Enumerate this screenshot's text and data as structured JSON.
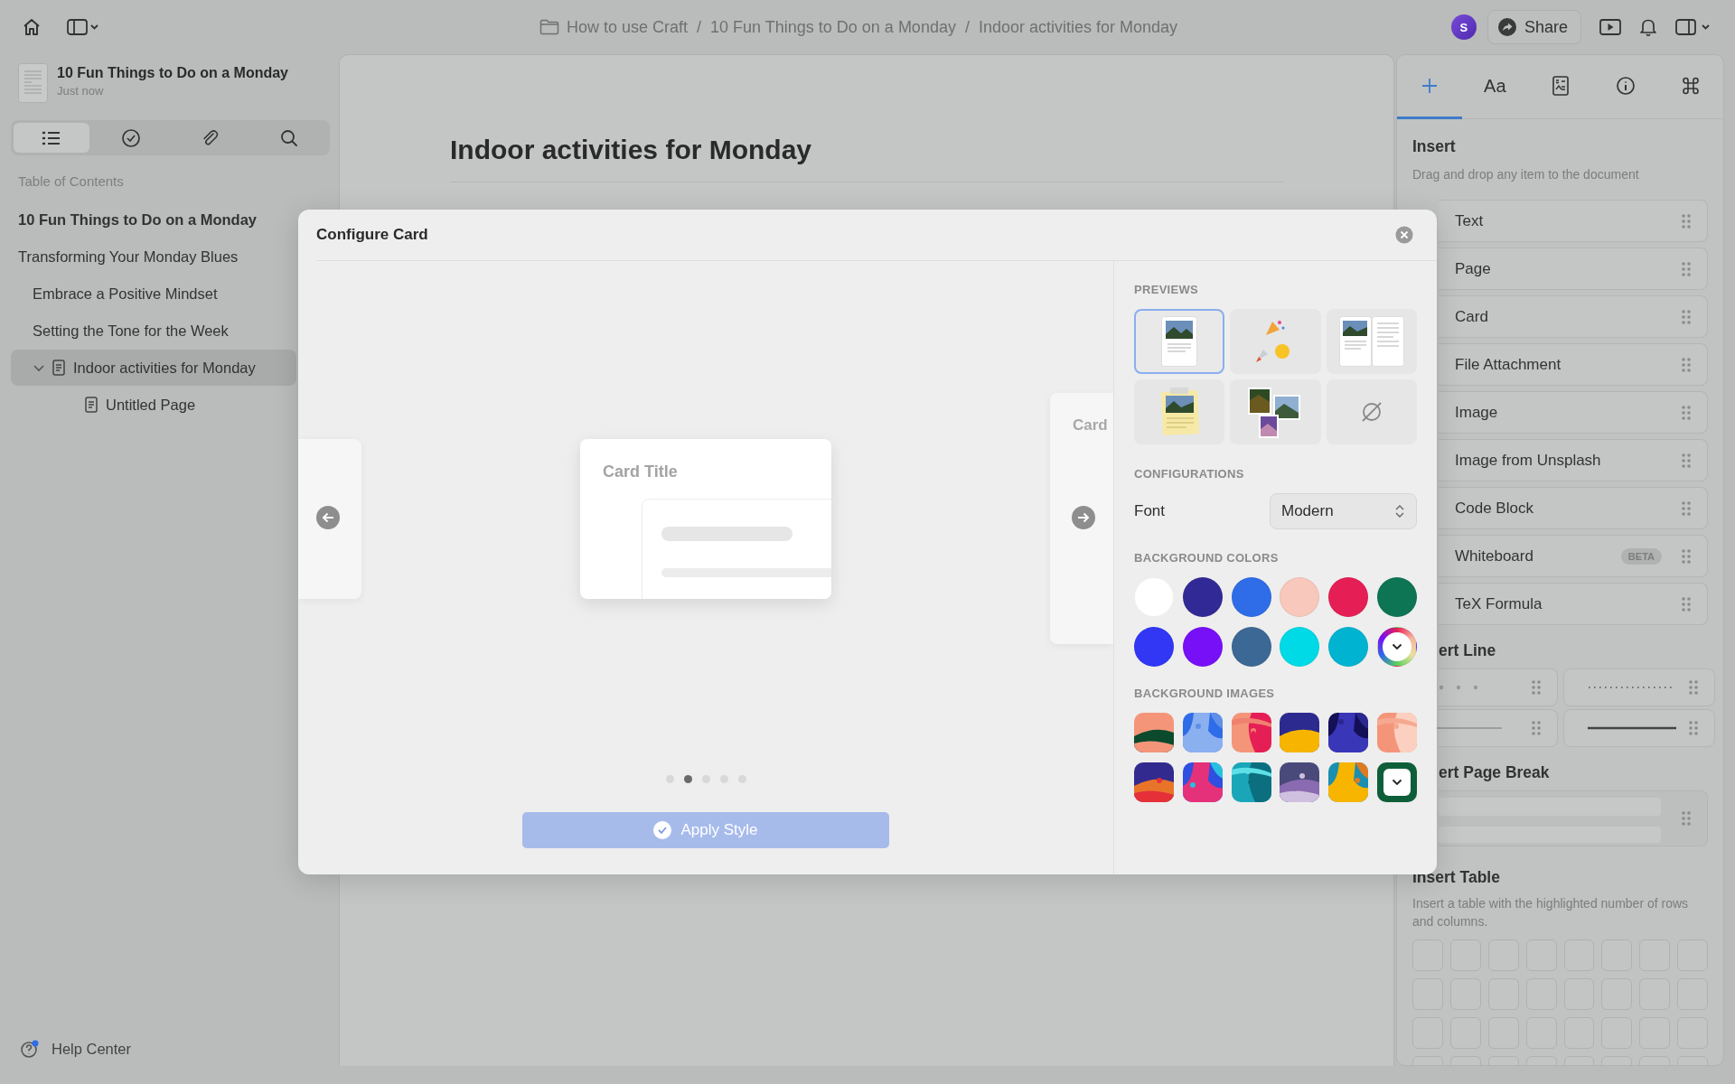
{
  "toolbar": {
    "breadcrumb": [
      {
        "label": "How to use Craft",
        "separator": "/"
      },
      {
        "label": "10 Fun Things to Do on a Monday",
        "separator": "/"
      },
      {
        "label": "Indoor activities for Monday"
      }
    ],
    "avatar": "S",
    "share": "Share"
  },
  "sidebar": {
    "document": {
      "title": "10 Fun Things to Do on a Monday",
      "updated": "Just now"
    },
    "view_tabs": [
      {
        "kind": "outline",
        "selected": true
      },
      {
        "kind": "tasks",
        "selected": false
      },
      {
        "kind": "attachments",
        "selected": false
      },
      {
        "kind": "search",
        "selected": false
      }
    ],
    "toc_heading": "Table of Contents",
    "toc": [
      {
        "kind": "document",
        "label": "10 Fun Things to Do on a Monday",
        "selected": false
      },
      {
        "kind": "heading",
        "label": "Transforming Your Monday Blues",
        "selected": false,
        "children": [
          {
            "kind": "heading",
            "label": "Embrace a Positive Mindset",
            "selected": false
          },
          {
            "kind": "heading",
            "label": "Setting the Tone for the Week",
            "selected": false
          },
          {
            "kind": "page",
            "label": "Indoor activities for Monday",
            "selected": true,
            "expanded": true,
            "children": [
              {
                "kind": "page",
                "label": "Untitled Page",
                "selected": false
              }
            ]
          }
        ]
      }
    ],
    "help": "Help Center"
  },
  "document": {
    "title": "Indoor activities for Monday"
  },
  "panel": {
    "tabs": [
      {
        "kind": "insert",
        "selected": true
      },
      {
        "kind": "style",
        "label": "Aa",
        "selected": false
      },
      {
        "kind": "card",
        "selected": false
      },
      {
        "kind": "info",
        "selected": false
      },
      {
        "kind": "shortcuts",
        "selected": false
      }
    ],
    "insert": {
      "title": "Insert",
      "hint": "Drag and drop any item to the document",
      "items": [
        {
          "label": "Text"
        },
        {
          "label": "Page"
        },
        {
          "label": "Card"
        },
        {
          "label": "File Attachment"
        },
        {
          "label": "Image"
        },
        {
          "label": "Image from Unsplash"
        },
        {
          "label": "Code Block"
        },
        {
          "label": "Whiteboard",
          "badge": "BETA"
        },
        {
          "label": "TeX Formula"
        }
      ]
    },
    "line": {
      "title": "ert Line",
      "options": [
        {
          "kind": "dots"
        },
        {
          "kind": "dotted"
        },
        {
          "kind": "thin"
        },
        {
          "kind": "thick"
        }
      ]
    },
    "page_break": {
      "title": "ert Page Break"
    },
    "table": {
      "title": "Insert Table",
      "hint": "Insert a table with the highlighted number of rows and columns."
    }
  },
  "modal": {
    "title": "Configure Card",
    "carousel": {
      "center_title": "Card Title",
      "next_title": "Card",
      "pages": [
        {
          "selected": false
        },
        {
          "selected": true
        },
        {
          "selected": false
        },
        {
          "selected": false
        },
        {
          "selected": false
        }
      ]
    },
    "apply_button": {
      "label": "Apply Style",
      "disabled": true
    },
    "previews": {
      "heading": "PREVIEWS",
      "items": [
        {
          "kind": "card",
          "selected": true
        },
        {
          "kind": "emoji",
          "selected": false
        },
        {
          "kind": "spread",
          "selected": false
        },
        {
          "kind": "note",
          "selected": false
        },
        {
          "kind": "collage",
          "selected": false
        },
        {
          "kind": "none",
          "selected": false
        }
      ]
    },
    "configurations": {
      "heading": "CONFIGURATIONS",
      "font": {
        "label": "Font",
        "value": "Modern"
      }
    },
    "background_colors": {
      "heading": "BACKGROUND COLORS",
      "items": [
        {
          "kind": "swatch",
          "color": "#ffffff"
        },
        {
          "kind": "swatch",
          "color": "#312a96"
        },
        {
          "kind": "swatch",
          "color": "#2f6ce8"
        },
        {
          "kind": "swatch",
          "color": "#f8c8bd"
        },
        {
          "kind": "swatch",
          "color": "#e51f55"
        },
        {
          "kind": "swatch",
          "color": "#0d7553"
        },
        {
          "kind": "swatch",
          "color": "#3137f5"
        },
        {
          "kind": "swatch",
          "color": "#7710f7"
        },
        {
          "kind": "swatch",
          "color": "#3c6895"
        },
        {
          "kind": "swatch",
          "color": "#00d9e6"
        },
        {
          "kind": "swatch",
          "color": "#00b4d1"
        },
        {
          "kind": "picker"
        }
      ]
    },
    "background_images": {
      "heading": "BACKGROUND IMAGES",
      "items": [
        {
          "kind": "picture"
        },
        {
          "kind": "picture"
        },
        {
          "kind": "picture"
        },
        {
          "kind": "picture"
        },
        {
          "kind": "picture"
        },
        {
          "kind": "picture"
        },
        {
          "kind": "picture"
        },
        {
          "kind": "picture"
        },
        {
          "kind": "picture"
        },
        {
          "kind": "picture"
        },
        {
          "kind": "picture"
        },
        {
          "kind": "more"
        }
      ]
    }
  }
}
